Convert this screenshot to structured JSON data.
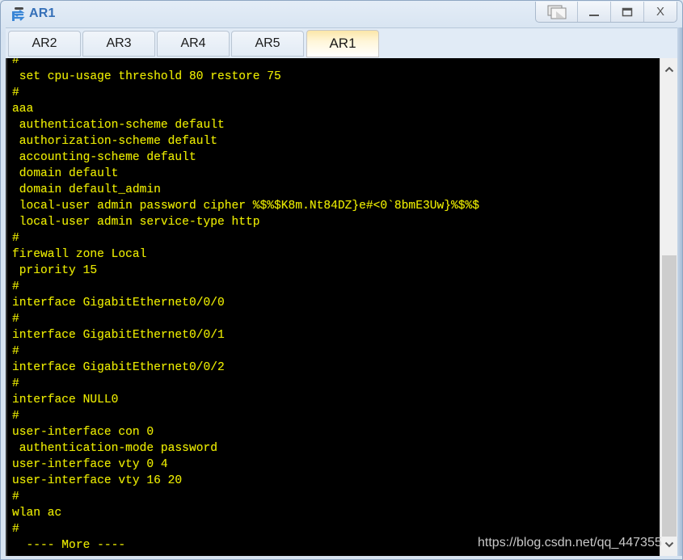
{
  "window": {
    "title": "AR1",
    "icon": "router-icon",
    "controls": [
      {
        "name": "restore-windows-button",
        "icon": "windows-stack-icon",
        "glyph": "❐"
      },
      {
        "name": "minimize-button",
        "icon": "minimize-icon",
        "glyph": "–"
      },
      {
        "name": "maximize-button",
        "icon": "maximize-icon",
        "glyph": "▭"
      },
      {
        "name": "close-button",
        "icon": "close-icon",
        "glyph": "X"
      }
    ]
  },
  "tabs": [
    {
      "label": "AR2",
      "active": false
    },
    {
      "label": "AR3",
      "active": false
    },
    {
      "label": "AR4",
      "active": false
    },
    {
      "label": "AR5",
      "active": false
    },
    {
      "label": "AR1",
      "active": true
    }
  ],
  "terminal": {
    "text_color": "#e6e600",
    "background": "#000000",
    "lines": [
      "#",
      " set cpu-usage threshold 80 restore 75",
      "#",
      "aaa",
      " authentication-scheme default",
      " authorization-scheme default",
      " accounting-scheme default",
      " domain default",
      " domain default_admin",
      " local-user admin password cipher %$%$K8m.Nt84DZ}e#<0`8bmE3Uw}%$%$",
      " local-user admin service-type http",
      "#",
      "firewall zone Local",
      " priority 15",
      "#",
      "interface GigabitEthernet0/0/0",
      "#",
      "interface GigabitEthernet0/0/1",
      "#",
      "interface GigabitEthernet0/0/2",
      "#",
      "interface NULL0",
      "#",
      "user-interface con 0",
      " authentication-mode password",
      "user-interface vty 0 4",
      "user-interface vty 16 20",
      "#",
      "wlan ac",
      "#",
      "  ---- More ----"
    ]
  },
  "scrollbar": {
    "up_glyph": "⌃",
    "down_glyph": "⌄",
    "position_fraction": 0.42,
    "visible_fraction": 0.58
  },
  "watermark": "https://blog.csdn.net/qq_447355"
}
